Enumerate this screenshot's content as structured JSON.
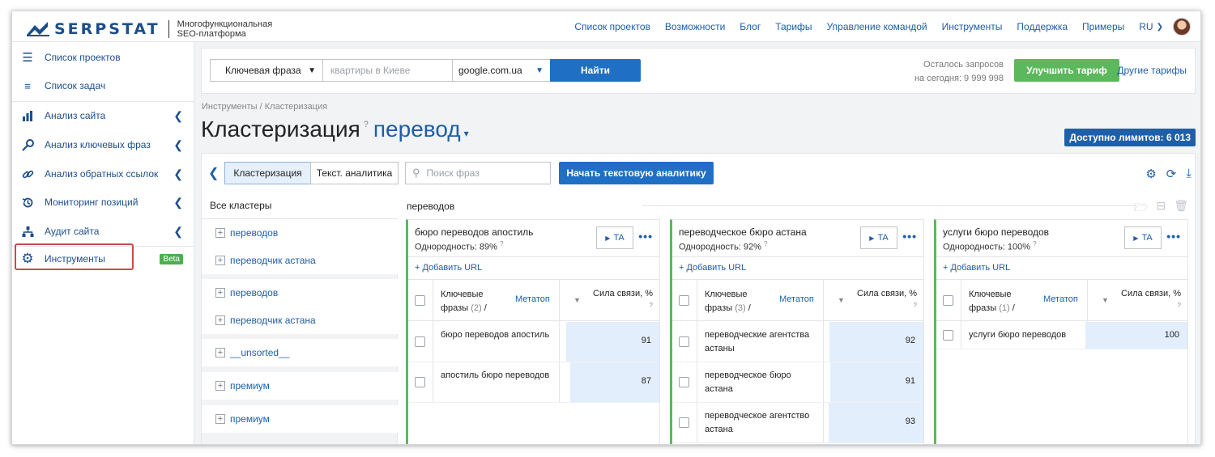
{
  "header": {
    "logo": "SERPSTAT",
    "tagline_1": "Многофункциональная",
    "tagline_2": "SEO-платформа",
    "nav": [
      "Список проектов",
      "Возможности",
      "Блог",
      "Тарифы",
      "Управление командой",
      "Инструменты",
      "Поддержка",
      "Примеры"
    ],
    "lang": "RU"
  },
  "sidebar": {
    "items": [
      {
        "label": "Список проектов",
        "icon": "menu-icon"
      },
      {
        "label": "Список задач",
        "icon": "list-icon"
      },
      {
        "label": "Анализ сайта",
        "icon": "chart-icon"
      },
      {
        "label": "Анализ ключевых фраз",
        "icon": "key-icon"
      },
      {
        "label": "Анализ обратных ссылок",
        "icon": "link-icon"
      },
      {
        "label": "Мониторинг позиций",
        "icon": "history-icon"
      },
      {
        "label": "Аудит сайта",
        "icon": "sitemap-icon"
      },
      {
        "label": "Инструменты",
        "icon": "gear-icon"
      }
    ],
    "beta": "Beta"
  },
  "search": {
    "mode": "Ключевая фраза",
    "placeholder": "квартиры в Киеве",
    "engine": "google.com.ua",
    "find": "Найти",
    "quota_1": "Осталось запросов",
    "quota_2": "на сегодня: 9 999 998",
    "upgrade": "Улучшить тариф",
    "other": "Другие тарифы"
  },
  "page": {
    "breadcrumb": "Инструменты / Кластеризация",
    "title": "Кластеризация",
    "project": "перевод",
    "limits": "Доступно лимитов: 6 013"
  },
  "toolbar": {
    "tab_clusters": "Кластеризация",
    "tab_text": "Текст. аналитика",
    "search_placeholder": "Поиск фраз",
    "start": "Начать текстовую аналитику"
  },
  "clusters_list": {
    "header": "Все кластеры",
    "group1": [
      "переводов",
      "переводчик астана"
    ],
    "group2": [
      "переводов",
      "переводчик астана"
    ],
    "group3": [
      "__unsorted__"
    ],
    "group4": [
      "премиум"
    ],
    "group5": [
      "премиум"
    ]
  },
  "clusters_area": {
    "name": "переводов"
  },
  "cards": [
    {
      "title": "бюро переводов апостиль",
      "homogeneity": "Однородность: 89%",
      "ta": "TA",
      "add_url": "+ Добавить URL",
      "th_kw_1": "Ключевые",
      "th_kw_2": "фразы",
      "th_kw_cnt": "(2)",
      "th_meta": "Метатоп",
      "th_strength": "Сила связи, %",
      "rows": [
        {
          "kw": "бюро переводов апостиль",
          "val": 91
        },
        {
          "kw": "апостиль бюро переводов",
          "val": 87
        }
      ]
    },
    {
      "title": "переводческое бюро астана",
      "homogeneity": "Однородность: 92%",
      "ta": "TA",
      "add_url": "+ Добавить URL",
      "th_kw_1": "Ключевые",
      "th_kw_2": "фразы",
      "th_kw_cnt": "(3)",
      "th_meta": "Метатоп",
      "th_strength": "Сила связи, %",
      "rows": [
        {
          "kw": "переводческие агентства астаны",
          "val": 92
        },
        {
          "kw": "переводческое бюро астана",
          "val": 91
        },
        {
          "kw": "переводческое агентство астана",
          "val": 93
        }
      ]
    },
    {
      "title": "услуги бюро переводов",
      "homogeneity": "Однородность: 100%",
      "ta": "TA",
      "add_url": "+ Добавить URL",
      "th_kw_1": "Ключевые",
      "th_kw_2": "фразы",
      "th_kw_cnt": "(1)",
      "th_meta": "Метатоп",
      "th_strength": "Сила связи, %",
      "rows": [
        {
          "kw": "услуги бюро переводов",
          "val": 100
        }
      ]
    }
  ]
}
